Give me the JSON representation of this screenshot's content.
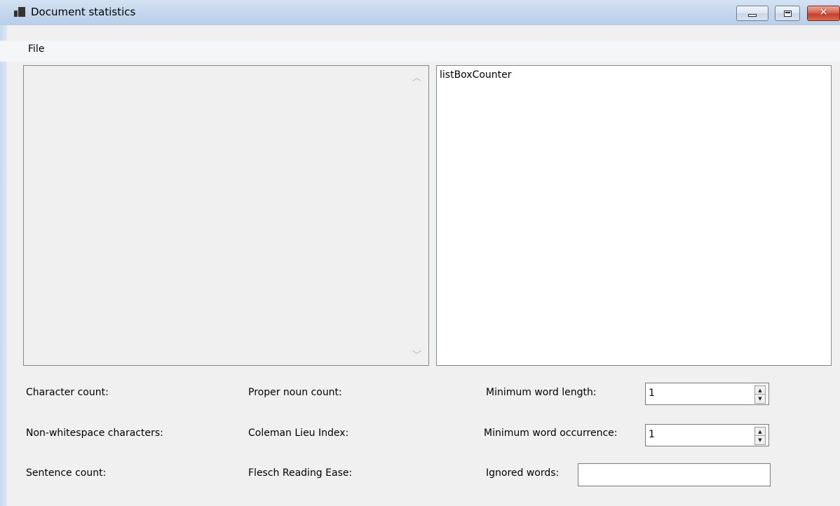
{
  "window": {
    "title": "Document statistics",
    "controls": {
      "minimize": "minimize",
      "maximize": "maximize",
      "close": "✕"
    }
  },
  "menu": {
    "file": "File"
  },
  "text_area": {
    "value": ""
  },
  "list_box": {
    "items": [
      "listBoxCounter"
    ]
  },
  "stats": {
    "character_count": "Character count:",
    "non_whitespace": "Non-whitespace characters:",
    "sentence_count": "Sentence count:",
    "proper_noun_count": "Proper noun count:",
    "coleman_liau": "Coleman Lieu Index:",
    "flesch": "Flesch Reading Ease:"
  },
  "settings": {
    "min_word_length_label": "Minimum word length:",
    "min_word_length_value": "1",
    "min_word_occurrence_label": "Minimum word occurrence:",
    "min_word_occurrence_value": "1",
    "ignored_words_label": "Ignored words:",
    "ignored_words_value": ""
  },
  "icons": {
    "app": "application-icon",
    "scroll_up": "scroll-up-icon",
    "scroll_down": "scroll-down-icon",
    "spin_up": "spin-up-icon",
    "spin_down": "spin-down-icon"
  },
  "colors": {
    "titlebar": "#c5d7ee",
    "close_button": "#c4402a",
    "form_background": "#f0f0f0",
    "border": "#828790"
  }
}
